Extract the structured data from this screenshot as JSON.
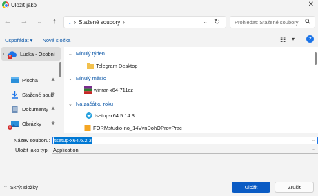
{
  "window": {
    "title": "Uložit jako",
    "close": "✕"
  },
  "nav": {
    "address": "Stažené soubory",
    "search_placeholder": "Prohledat: Stažené soubory"
  },
  "toolbar": {
    "organize": "Uspořádat ▾",
    "new_folder": "Nová složka"
  },
  "sidebar": {
    "items": [
      {
        "label": "Lucka - Osobní"
      },
      {
        "label": "Plocha"
      },
      {
        "label": "Stažené soub"
      },
      {
        "label": "Dokumenty"
      },
      {
        "label": "Obrázky"
      }
    ]
  },
  "main": {
    "groups": [
      {
        "label": "Minulý týden",
        "files": [
          "Telegram Desktop"
        ]
      },
      {
        "label": "Minulý měsíc",
        "files": [
          "winrar-x64-711cz"
        ]
      },
      {
        "label": "Na začátku roku",
        "files": [
          "tsetup-x64.5.14.3",
          "FORMstudio-no_14VvnDohOProvPrac"
        ]
      }
    ]
  },
  "fields": {
    "filename_label": "Název souboru:",
    "filename_value": "tsetup-x64.6.2.3",
    "type_label": "Uložit jako typ:",
    "type_value": "Application"
  },
  "footer": {
    "hide_folders": "Skrýt složky",
    "save": "Uložit",
    "cancel": "Zrušit"
  },
  "colors": {
    "accent": "#0a5bc4",
    "link": "#0b57a8",
    "folder": "#f2c14e"
  }
}
